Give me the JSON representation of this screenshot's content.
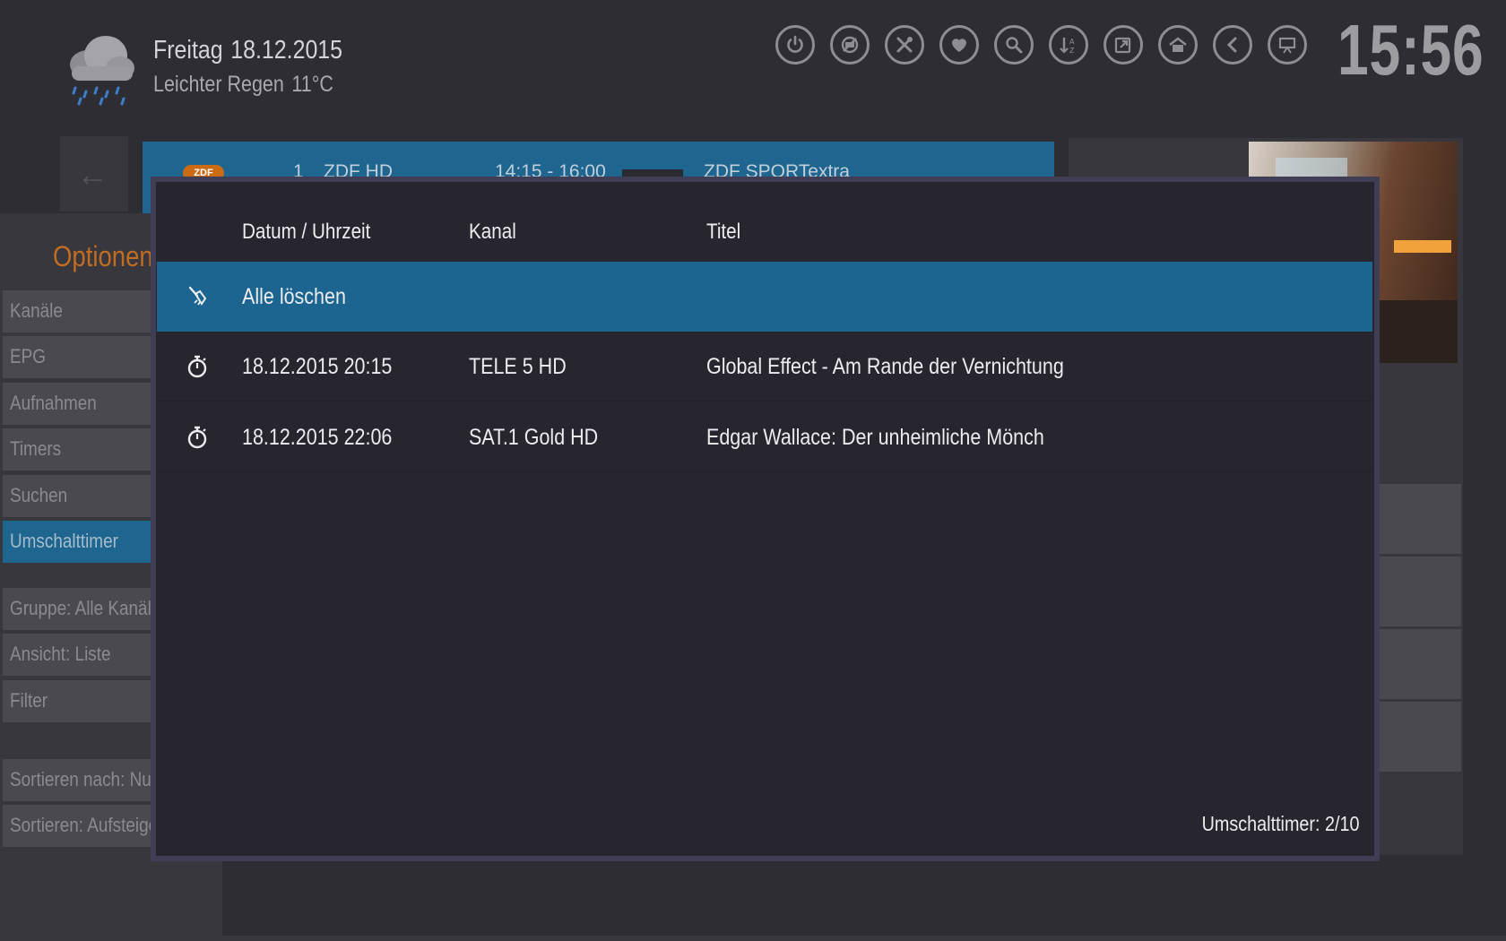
{
  "header": {
    "weekday": "Freitag",
    "date": "18.12.2015",
    "weather": "Leichter Regen",
    "temperature": "11°C",
    "clock": "15:56",
    "icons": [
      "power-icon",
      "no-entry-icon",
      "tools-icon",
      "heart-icon",
      "search-icon",
      "sort-az-icon",
      "export-icon",
      "home-icon",
      "back-icon",
      "presentation-icon"
    ]
  },
  "background_row": {
    "number": "1",
    "channel": "ZDF HD",
    "time": "14:15 - 16:00",
    "title": "ZDF SPORTextra"
  },
  "sidebar": {
    "title": "Optionen",
    "items": [
      {
        "label": "Kanäle"
      },
      {
        "label": "EPG"
      },
      {
        "label": "Aufnahmen"
      },
      {
        "label": "Timers"
      },
      {
        "label": "Suchen"
      },
      {
        "label": "Umschalttimer"
      },
      {
        "label": "Gruppe: Alle Kanäle"
      },
      {
        "label": "Ansicht: Liste"
      },
      {
        "label": "Filter"
      },
      {
        "label": "Sortieren nach: Nummer"
      },
      {
        "label": "Sortieren: Aufsteigend"
      }
    ]
  },
  "dialog": {
    "columns": {
      "datetime": "Datum / Uhrzeit",
      "channel": "Kanal",
      "title": "Titel"
    },
    "clear_all": "Alle löschen",
    "rows": [
      {
        "datetime": "18.12.2015 20:15",
        "channel": "TELE 5 HD",
        "title": "Global Effect - Am Rande der Vernichtung"
      },
      {
        "datetime": "18.12.2015 22:06",
        "channel": "SAT.1 Gold HD",
        "title": "Edgar Wallace: Der unheimliche Mönch"
      }
    ],
    "counter": "Umschalttimer: 2/10"
  },
  "colors": {
    "accent_blue": "#1c6590",
    "accent_orange": "#c06d22",
    "dialog_bg": "#27262f",
    "page_bg": "#2e2d33"
  }
}
